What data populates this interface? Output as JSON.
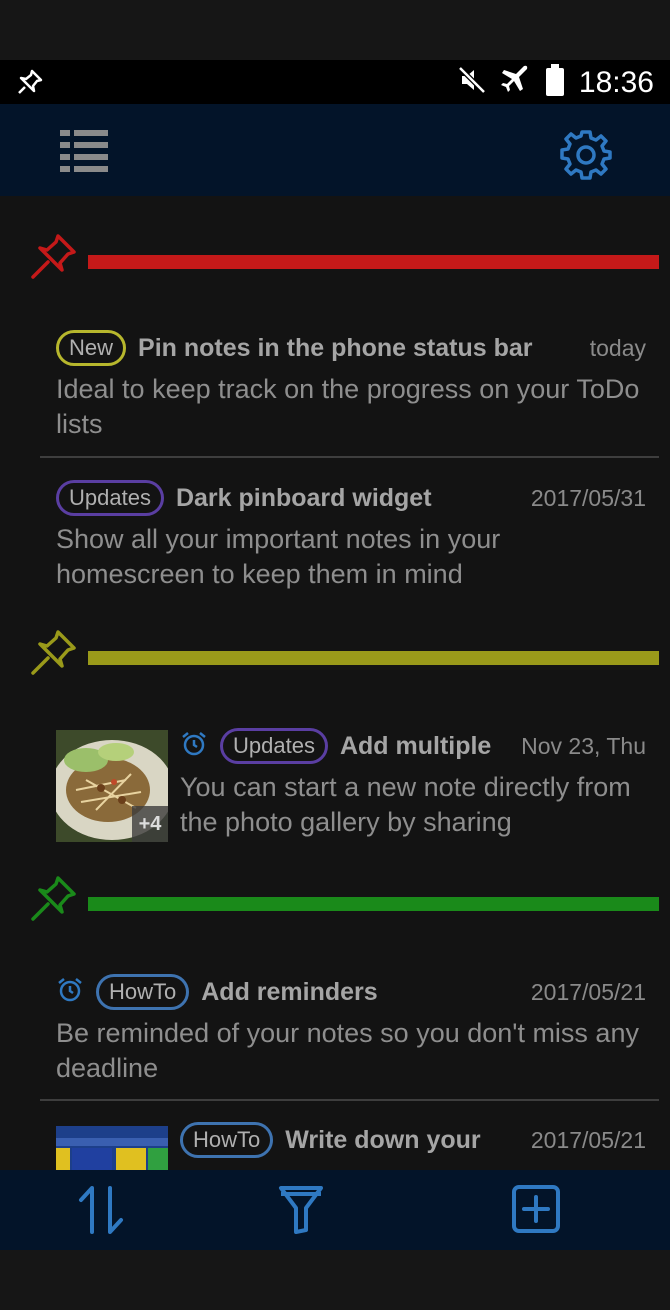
{
  "status_bar": {
    "time": "18:36",
    "icons": [
      "pin-icon",
      "mute-icon",
      "airplane-icon",
      "battery-icon"
    ]
  },
  "app_bar": {
    "menu_icon": "list-icon",
    "settings_icon": "gear-icon"
  },
  "sections": [
    {
      "color": "#c51919",
      "notes": [
        {
          "tag": "New",
          "title": "Pin notes in the phone status bar",
          "date": "today",
          "body": "Ideal to keep track on the progress on your ToDo lists"
        },
        {
          "tag": "Updates",
          "title": "Dark pinboard widget",
          "date": "2017/05/31",
          "body": "Show all your important notes in your homescreen to keep them in mind"
        }
      ]
    },
    {
      "color": "#9a9a1a",
      "notes": [
        {
          "tag": "Updates",
          "title": "Add multiple",
          "date": "Nov 23, Thu",
          "body": "You can start a new note directly from the photo gallery by sharing",
          "thumb_badge": "+4"
        }
      ]
    },
    {
      "color": "#1a8a1a",
      "notes": [
        {
          "tag": "HowTo",
          "title": "Add reminders",
          "date": "2017/05/21",
          "body": "Be reminded of your notes so you don't miss any deadline"
        },
        {
          "tag": "HowTo",
          "title": "Write down your",
          "date": "2017/05/21",
          "body": ""
        }
      ]
    }
  ],
  "colors": {
    "accent": "#2f79c2",
    "appbar_bg": "#031429"
  },
  "bottom_bar": {
    "icons": [
      "sort-icon",
      "filter-icon",
      "add-note-icon"
    ]
  }
}
